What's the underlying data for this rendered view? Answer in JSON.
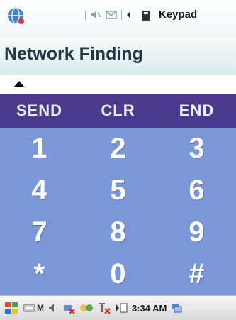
{
  "status": {
    "keypad_label": "Keypad"
  },
  "title": "Network Finding",
  "commands": [
    {
      "label": "SEND"
    },
    {
      "label": "CLR"
    },
    {
      "label": "END"
    }
  ],
  "keys": [
    {
      "label": "1"
    },
    {
      "label": "2"
    },
    {
      "label": "3"
    },
    {
      "label": "4"
    },
    {
      "label": "5"
    },
    {
      "label": "6"
    },
    {
      "label": "7"
    },
    {
      "label": "8"
    },
    {
      "label": "9"
    },
    {
      "label": "*"
    },
    {
      "label": "0"
    },
    {
      "label": "#"
    }
  ],
  "taskbar": {
    "ime_label": "M",
    "time": "3:34 AM"
  },
  "colors": {
    "command_bar": "#4b398d",
    "keypad_background": "#7a98d8",
    "key_text": "#ffffff"
  }
}
